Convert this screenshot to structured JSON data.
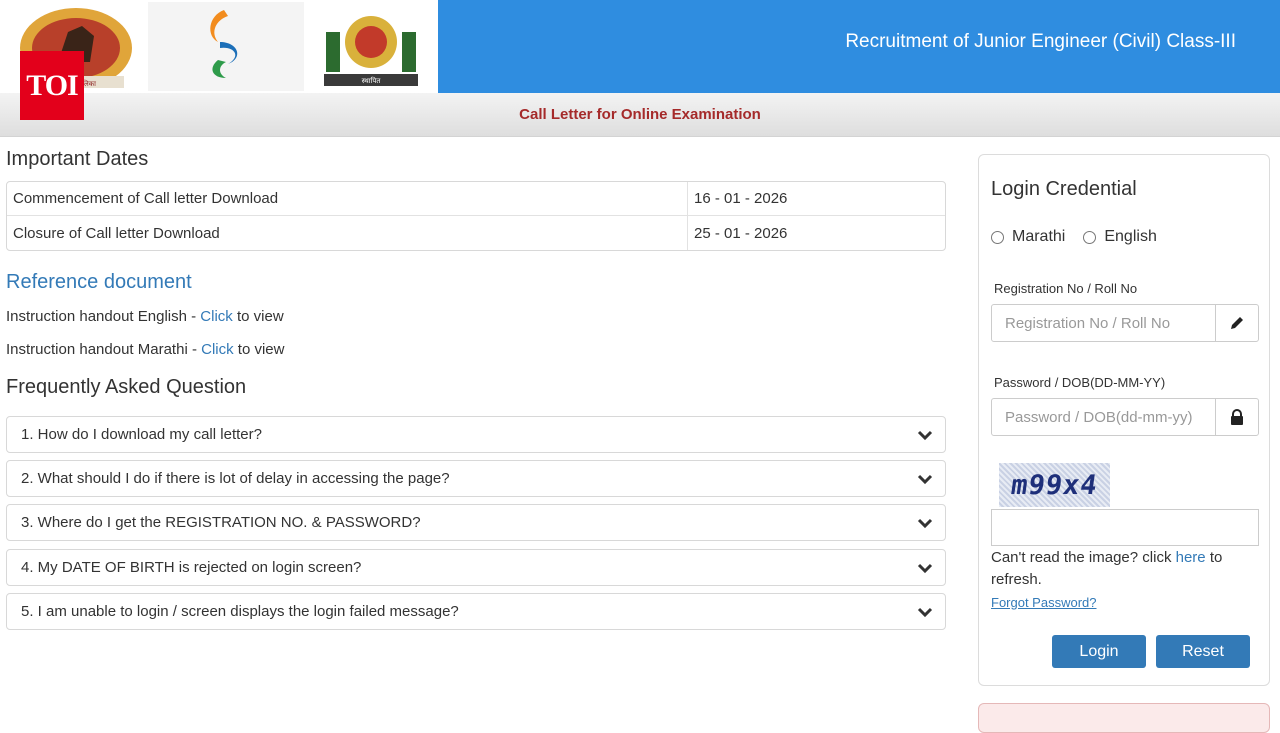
{
  "header": {
    "title": "Recruitment of Junior Engineer (Civil) Class-III",
    "toi_badge": "TOI",
    "logo1_caption": "महानगरपालिका",
    "logo3_caption": "स्थापित"
  },
  "subbar": {
    "title": "Call Letter for Online Examination"
  },
  "important_dates": {
    "title": "Important Dates",
    "rows": [
      {
        "label": "Commencement of Call letter Download",
        "value": "16 - 01 - 2026"
      },
      {
        "label": "Closure of Call letter Download",
        "value": "25 - 01 - 2026"
      }
    ]
  },
  "reference": {
    "title": "Reference document",
    "items": [
      {
        "prefix": "Instruction handout English - ",
        "link": "Click",
        "suffix": " to view"
      },
      {
        "prefix": "Instruction handout Marathi - ",
        "link": "Click",
        "suffix": " to view"
      }
    ]
  },
  "faq": {
    "title": "Frequently Asked Question",
    "items": [
      "1. How do I download my call letter?",
      "2. What should I do if there is lot of delay in accessing the page?",
      "3. Where do I get the REGISTRATION NO. & PASSWORD?",
      "4. My DATE OF BIRTH is rejected on login screen?",
      "5. I am unable to login / screen displays the login failed message?"
    ]
  },
  "login": {
    "title": "Login Credential",
    "languages": [
      "Marathi",
      "English"
    ],
    "reg_label": "Registration No / Roll No",
    "reg_placeholder": "Registration No / Roll No",
    "pwd_label": "Password / DOB(DD-MM-YY)",
    "pwd_placeholder": "Password / DOB(dd-mm-yy)",
    "captcha_text": "m99x4",
    "refresh_prefix": "Can't read the image? click ",
    "refresh_link": "here",
    "refresh_suffix": " to refresh.",
    "forgot": "Forgot Password?",
    "login_button": "Login",
    "reset_button": "Reset"
  },
  "colors": {
    "header_blue": "#2f8de0",
    "link_blue": "#337ab7",
    "subtitle_red": "#a52a2a",
    "toi_red": "#e3001b"
  },
  "icons": [
    "pencil-icon",
    "lock-icon",
    "chevron-down-icon"
  ]
}
